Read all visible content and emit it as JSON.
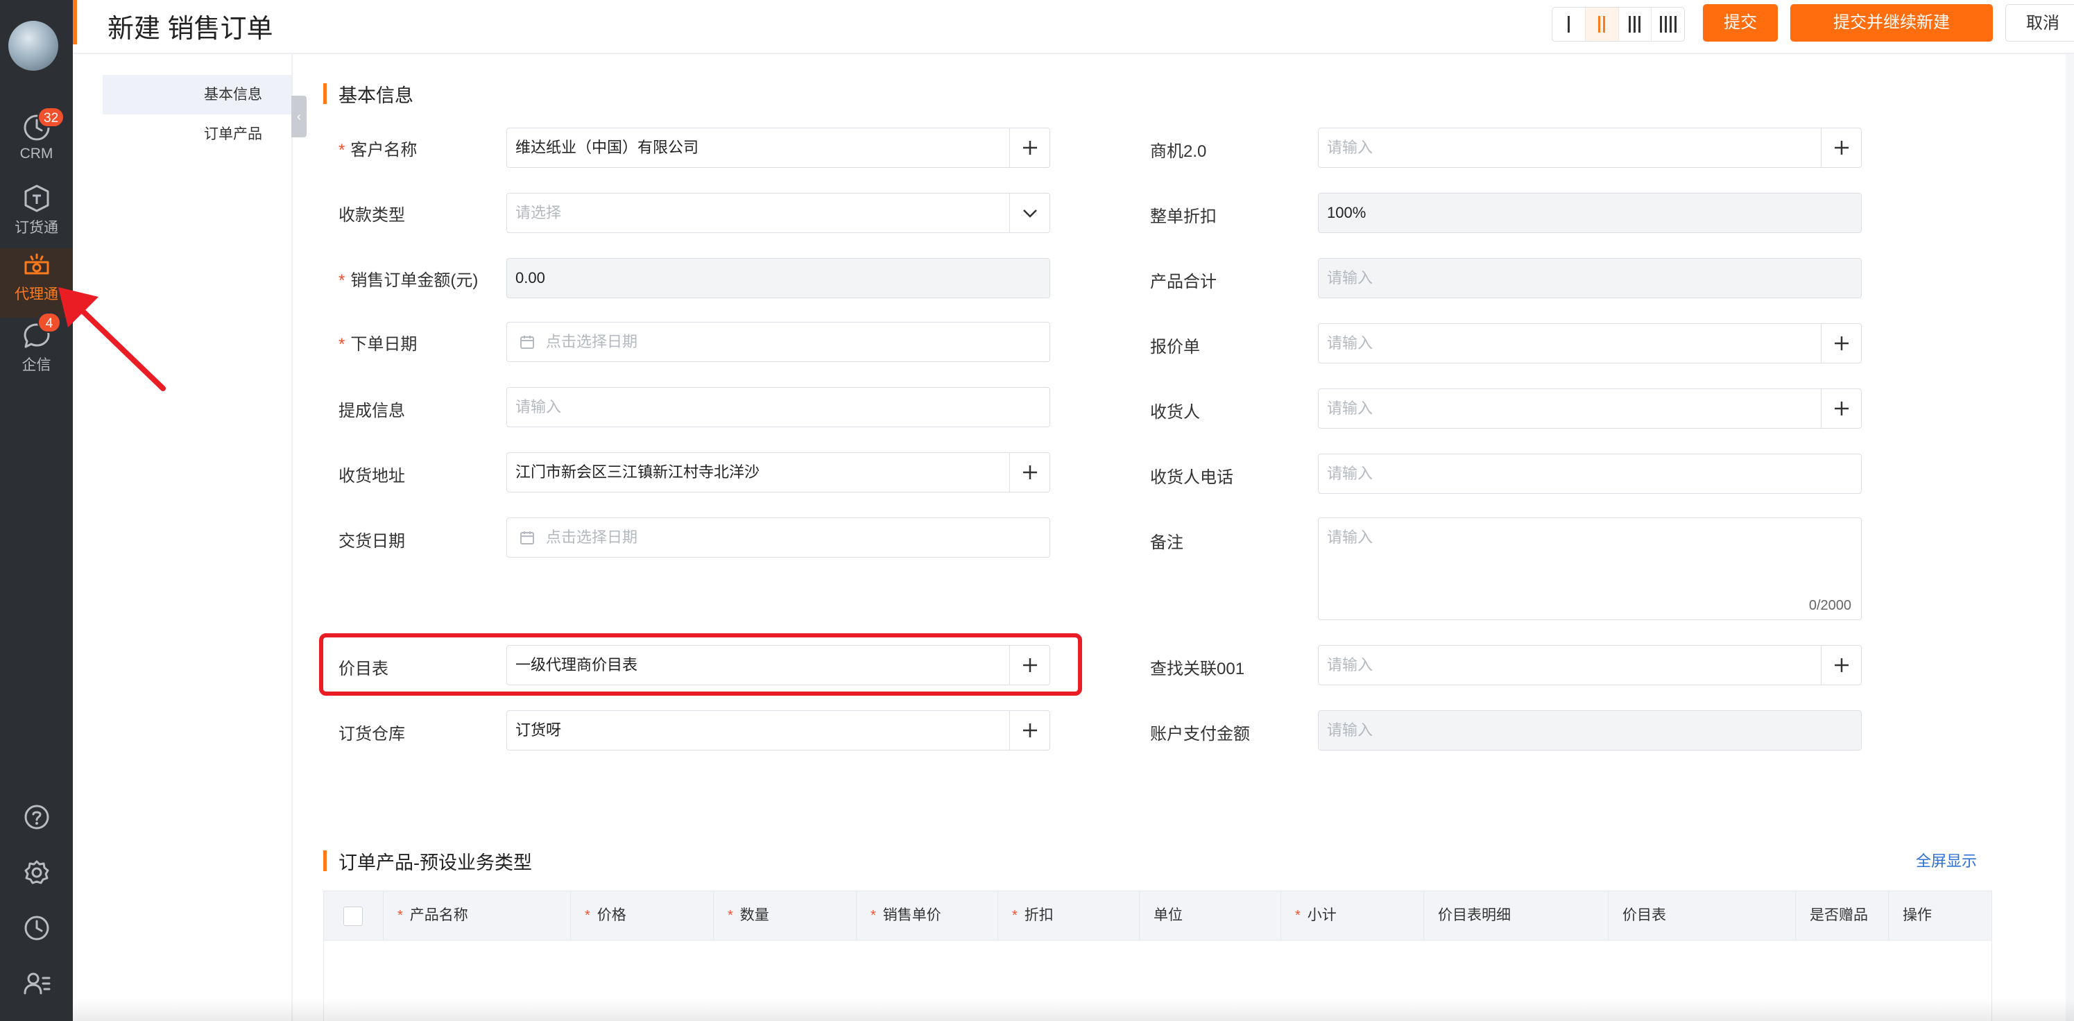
{
  "rail": {
    "items": [
      {
        "label": "CRM",
        "badge": "32",
        "icon": "clock-icon"
      },
      {
        "label": "订货通",
        "icon": "order-box-icon"
      },
      {
        "label": "代理通",
        "icon": "agent-icon",
        "active": true
      },
      {
        "label": "企信",
        "badge": "4",
        "icon": "chat-icon"
      }
    ],
    "bottom_icons": [
      "help-icon",
      "gear-icon",
      "history-icon",
      "user-settings-icon"
    ]
  },
  "header": {
    "title": "新建 销售订单",
    "submit": "提交",
    "submit_new": "提交并继续新建",
    "cancel": "取消"
  },
  "sidenav": {
    "items": [
      "基本信息",
      "订单产品"
    ]
  },
  "section_basic": {
    "title": "基本信息"
  },
  "form": {
    "customer": {
      "label": "客户名称",
      "value": "维达纸业（中国）有限公司"
    },
    "payment_type": {
      "label": "收款类型",
      "placeholder": "请选择"
    },
    "amount": {
      "label": "销售订单金额(元)",
      "value": "0.00"
    },
    "order_date": {
      "label": "下单日期",
      "placeholder": "点击选择日期"
    },
    "commission": {
      "label": "提成信息",
      "placeholder": "请输入"
    },
    "address": {
      "label": "收货地址",
      "value": "江门市新会区三江镇新江村寺北洋沙"
    },
    "delivery_date": {
      "label": "交货日期",
      "placeholder": "点击选择日期"
    },
    "price_list": {
      "label": "价目表",
      "value": "一级代理商价目表"
    },
    "warehouse": {
      "label": "订货仓库",
      "value": "订货呀"
    },
    "opportunity": {
      "label": "商机2.0",
      "placeholder": "请输入"
    },
    "discount": {
      "label": "整单折扣",
      "value": "100%"
    },
    "product_total": {
      "label": "产品合计",
      "placeholder": "请输入"
    },
    "quote": {
      "label": "报价单",
      "placeholder": "请输入"
    },
    "receiver": {
      "label": "收货人",
      "placeholder": "请输入"
    },
    "receiver_phone": {
      "label": "收货人电话",
      "placeholder": "请输入"
    },
    "remark": {
      "label": "备注",
      "placeholder": "请输入",
      "count": "0/2000"
    },
    "lookup": {
      "label": "查找关联001",
      "placeholder": "请输入"
    },
    "account_pay": {
      "label": "账户支付金额",
      "placeholder": "请输入"
    }
  },
  "section_products": {
    "title": "订单产品-预设业务类型",
    "fullscreen": "全屏显示",
    "columns": [
      "产品名称",
      "价格",
      "数量",
      "销售单价",
      "折扣",
      "单位",
      "小计",
      "价目表明细",
      "价目表",
      "是否赠品",
      "操作"
    ]
  },
  "colors": {
    "accent": "#ff6d0e",
    "highlight": "#ea1c24",
    "link": "#2c6fd6"
  }
}
